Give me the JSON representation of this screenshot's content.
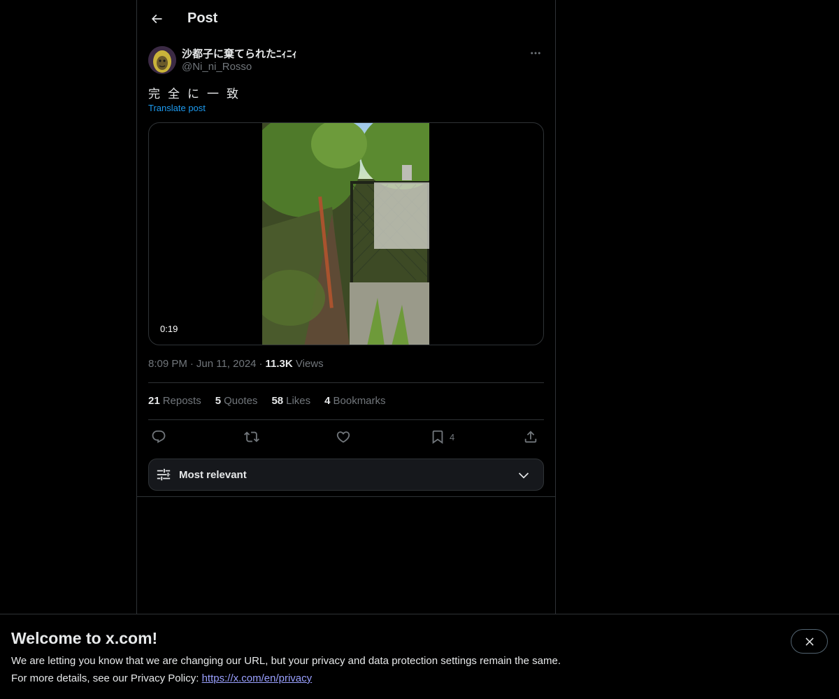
{
  "header": {
    "title": "Post"
  },
  "post": {
    "author": {
      "display_name": "沙都子に棄てられたﾆｨﾆｨ",
      "handle": "@Ni_ni_Rosso"
    },
    "text": "完全に一致",
    "translate_label": "Translate post",
    "media": {
      "type": "video",
      "duration": "0:19"
    },
    "time": "8:09 PM",
    "date": "Jun 11, 2024",
    "views_count": "11.3K",
    "views_label": "Views",
    "stats": [
      {
        "count": "21",
        "label": "Reposts"
      },
      {
        "count": "5",
        "label": "Quotes"
      },
      {
        "count": "58",
        "label": "Likes"
      },
      {
        "count": "4",
        "label": "Bookmarks"
      }
    ],
    "actions": {
      "bookmark_count": "4"
    }
  },
  "sort": {
    "label": "Most relevant"
  },
  "banner": {
    "title": "Welcome to x.com!",
    "line1": "We are letting you know that we are changing our URL, but your privacy and data protection settings remain the same.",
    "line2_prefix": "For more details, see our Privacy Policy: ",
    "link_text": "https://x.com/en/privacy"
  },
  "colors": {
    "background": "#000000",
    "accent": "#1d9bf0",
    "muted": "#71767b",
    "border": "#2f3336"
  },
  "icons": [
    "back-arrow-icon",
    "more-icon",
    "reply-icon",
    "repost-icon",
    "like-icon",
    "bookmark-icon",
    "share-icon",
    "sort-sliders-icon",
    "chevron-down-icon",
    "close-icon"
  ]
}
